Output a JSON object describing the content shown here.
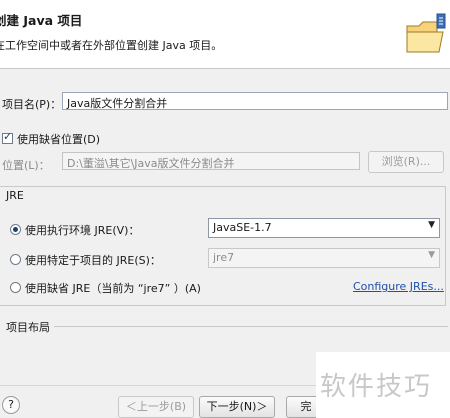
{
  "banner": {
    "title": "创建 Java 项目",
    "description": "在工作空间中或者在外部位置创建 Java 项目。"
  },
  "project_name": {
    "label": "项目名(P)：",
    "value": "Java版文件分割合并"
  },
  "use_default_location": {
    "label": "使用缺省位置(D)",
    "checked": true
  },
  "location": {
    "label": "位置(L)：",
    "value": "D:\\董溢\\其它\\Java版文件分割合并",
    "browse_label": "浏览(R)..."
  },
  "jre": {
    "group_label": "JRE",
    "options": [
      {
        "label": "使用执行环境 JRE(V)：",
        "selected": true,
        "combo_value": "JavaSE-1.7",
        "combo_enabled": true
      },
      {
        "label": "使用特定于项目的 JRE(S)：",
        "selected": false,
        "combo_value": "jre7",
        "combo_enabled": false
      },
      {
        "label": "使用缺省 JRE（当前为 “jre7” ）(A)",
        "selected": false
      }
    ],
    "configure_link": "Configure JREs..."
  },
  "project_layout": {
    "group_label": "项目布局"
  },
  "footer": {
    "help_symbol": "?",
    "back_label": "＜上一步(B)",
    "next_label": "下一步(N)＞",
    "finish_label": "完"
  },
  "watermark": "软件技巧",
  "icons": {
    "banner": "folder-icon",
    "help": "help-icon"
  },
  "colors": {
    "link": "#1f4fa8",
    "selected_radio": "#1d3f7a"
  }
}
